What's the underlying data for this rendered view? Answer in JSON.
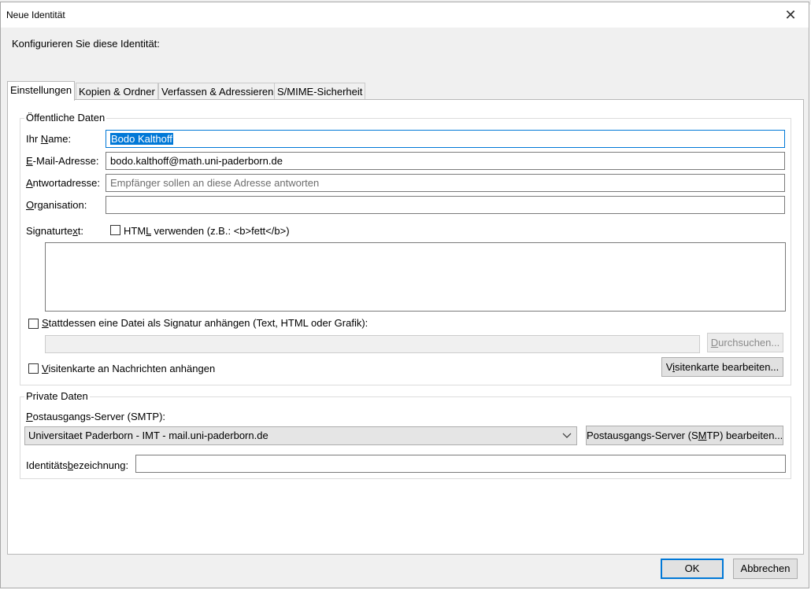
{
  "window": {
    "title": "Neue Identität",
    "close_glyph": "✕"
  },
  "subtitle": "Konfigurieren Sie diese Identität:",
  "tabs": [
    {
      "label": "Einstellungen",
      "active": true
    },
    {
      "label": "Kopien & Ordner",
      "active": false
    },
    {
      "label": "Verfassen & Adressieren",
      "active": false
    },
    {
      "label": "S/MIME-Sicherheit",
      "active": false
    }
  ],
  "public": {
    "legend": "Öffentliche Daten",
    "name": {
      "label_pre": "Ihr ",
      "label_u": "N",
      "label_post": "ame:",
      "value": "Bodo Kalthoff"
    },
    "email": {
      "label_pre": "",
      "label_u": "E",
      "label_post": "-Mail-Adresse:",
      "value": "bodo.kalthoff@math.uni-paderborn.de"
    },
    "reply": {
      "label_pre": "",
      "label_u": "A",
      "label_post": "ntwortadresse:",
      "value": "",
      "placeholder": "Empfänger sollen an diese Adresse antworten"
    },
    "org": {
      "label_pre": "",
      "label_u": "O",
      "label_post": "rganisation:",
      "value": ""
    },
    "signature": {
      "label_pre": "Signaturte",
      "label_u": "x",
      "label_post": "t:",
      "html_pre": "HTM",
      "html_u": "L",
      "html_post": " verwenden (z.B.: <b>fett</b>)",
      "html_checked": false,
      "value": ""
    },
    "attach_file": {
      "label_pre": "",
      "label_u": "S",
      "label_post": "tattdessen eine Datei als Signatur anhängen (Text, HTML oder Grafik):",
      "checked": false,
      "path": "",
      "browse_pre": "",
      "browse_u": "D",
      "browse_post": "urchsuchen..."
    },
    "vcard": {
      "label_pre": "",
      "label_u": "V",
      "label_post": "isitenkarte an Nachrichten anhängen",
      "checked": false,
      "edit_pre": "V",
      "edit_u": "i",
      "edit_post": "sitenkarte bearbeiten..."
    }
  },
  "private": {
    "legend": "Private Daten",
    "smtp": {
      "label_pre": "",
      "label_u": "P",
      "label_post": "ostausgangs-Server (SMTP):",
      "selected": "Universitaet Paderborn - IMT - mail.uni-paderborn.de",
      "edit_pre": "Postausgangs-Server (S",
      "edit_u": "M",
      "edit_post": "TP) bearbeiten..."
    },
    "identity": {
      "label_pre": "Identitäts",
      "label_u": "b",
      "label_post": "ezeichnung:",
      "value": ""
    }
  },
  "footer": {
    "ok_label": "OK",
    "cancel_label": "Abbrechen"
  },
  "colors": {
    "accent": "#0078d7",
    "dialog_bg": "#f0f0f0"
  }
}
